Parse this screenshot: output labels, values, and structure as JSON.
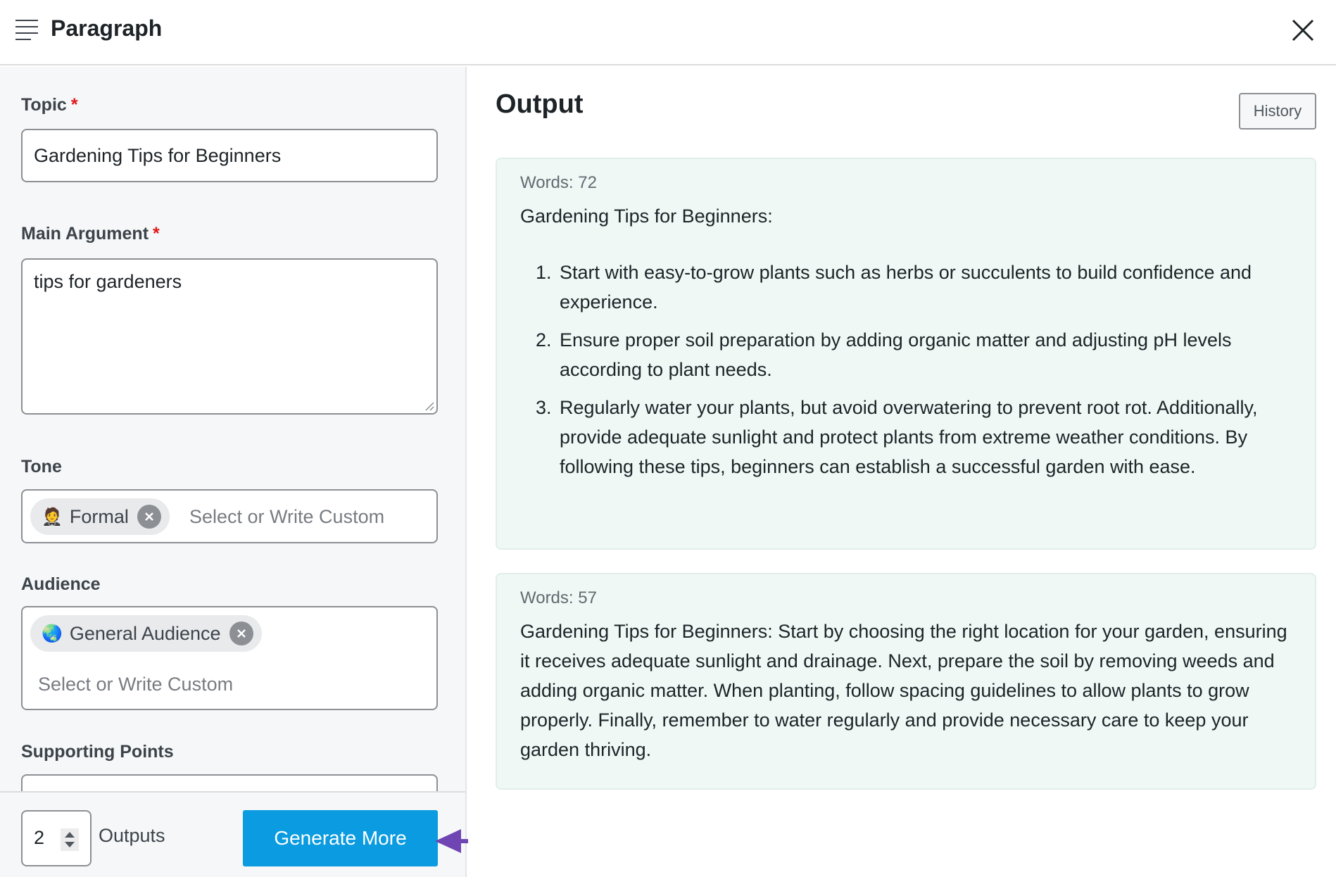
{
  "header": {
    "title": "Paragraph",
    "menu_icon": "hamburger-menu-icon",
    "close_icon": "close-icon"
  },
  "form": {
    "topic": {
      "label": "Topic",
      "required_marker": "*",
      "value": "Gardening Tips for Beginners"
    },
    "main_argument": {
      "label": "Main Argument",
      "required_marker": "*",
      "value": "tips for gardeners"
    },
    "tone": {
      "label": "Tone",
      "tags": [
        {
          "emoji": "🤵",
          "label": "Formal"
        }
      ],
      "placeholder": "Select or Write Custom"
    },
    "audience": {
      "label": "Audience",
      "tags": [
        {
          "emoji": "🌏",
          "label": "General Audience"
        }
      ],
      "placeholder": "Select or Write Custom"
    },
    "supporting_points": {
      "label": "Supporting Points"
    }
  },
  "footer": {
    "outputs_count": "2",
    "outputs_label": "Outputs",
    "generate_label": "Generate More"
  },
  "colors": {
    "accent": "#0b9be0",
    "arrow": "#6f44b3",
    "required": "#e0191b",
    "card_bg": "#eff8f5"
  },
  "output": {
    "title": "Output",
    "history_label": "History",
    "results": [
      {
        "words": "Words: 72",
        "heading": "Gardening Tips for Beginners:",
        "items": [
          {
            "num": "1.",
            "text": "Start with easy-to-grow plants such as herbs or succulents to build confidence and experience."
          },
          {
            "num": "2.",
            "text": "Ensure proper soil preparation by adding organic matter and adjusting pH levels according to plant needs."
          },
          {
            "num": "3.",
            "text": "Regularly water your plants, but avoid overwatering to prevent root rot. Additionally, provide adequate sunlight and protect plants from extreme weather conditions. By following these tips, beginners can establish a successful garden with ease."
          }
        ]
      },
      {
        "words": "Words: 57",
        "text": "Gardening Tips for Beginners: Start by choosing the right location for your garden, ensuring it receives adequate sunlight and drainage. Next, prepare the soil by removing weeds and adding organic matter. When planting, follow spacing guidelines to allow plants to grow properly. Finally, remember to water regularly and provide necessary care to keep your garden thriving."
      }
    ]
  }
}
